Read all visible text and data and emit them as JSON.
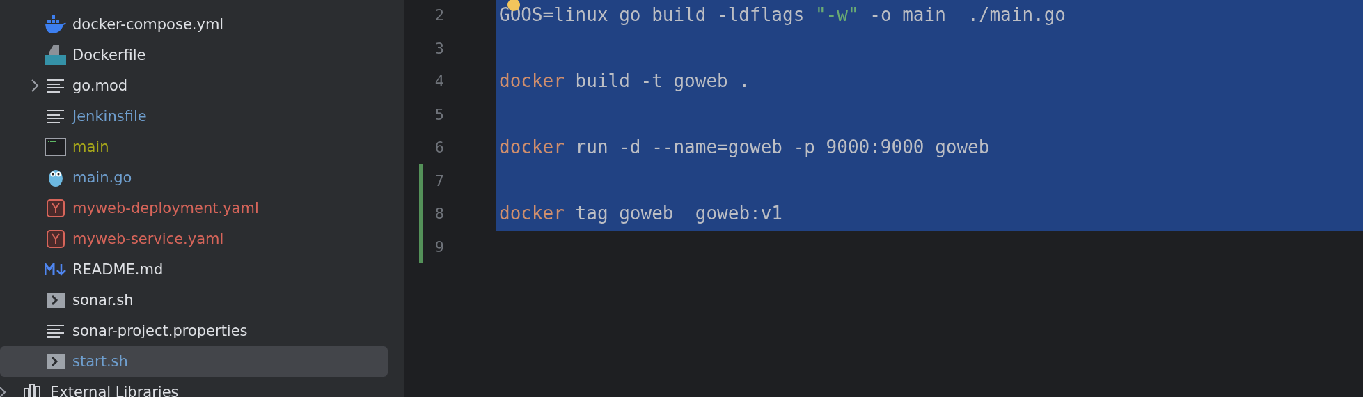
{
  "project_tree": {
    "items": [
      {
        "name": "docker-compose.yml",
        "kind": "docker",
        "color": "#dfe1e5",
        "has_children": false,
        "selected": false
      },
      {
        "name": "Dockerfile",
        "kind": "dockerfile",
        "color": "#dfe1e5",
        "has_children": false,
        "selected": false
      },
      {
        "name": "go.mod",
        "kind": "text",
        "color": "#dfe1e5",
        "has_children": true,
        "selected": false
      },
      {
        "name": "Jenkinsfile",
        "kind": "text",
        "color": "#6f9fcf",
        "has_children": false,
        "selected": false
      },
      {
        "name": "main",
        "kind": "binary",
        "color": "#a8a81a",
        "has_children": false,
        "selected": false
      },
      {
        "name": "main.go",
        "kind": "go",
        "color": "#6f9fcf",
        "has_children": false,
        "selected": false
      },
      {
        "name": "myweb-deployment.yaml",
        "kind": "yaml",
        "color": "#d7655a",
        "has_children": false,
        "selected": false
      },
      {
        "name": "myweb-service.yaml",
        "kind": "yaml",
        "color": "#d7655a",
        "has_children": false,
        "selected": false
      },
      {
        "name": "README.md",
        "kind": "markdown",
        "color": "#dfe1e5",
        "has_children": false,
        "selected": false
      },
      {
        "name": "sonar.sh",
        "kind": "shell",
        "color": "#dfe1e5",
        "has_children": false,
        "selected": false
      },
      {
        "name": "sonar-project.properties",
        "kind": "text",
        "color": "#dfe1e5",
        "has_children": false,
        "selected": false
      },
      {
        "name": "start.sh",
        "kind": "shell",
        "color": "#6f9fcf",
        "has_children": false,
        "selected": true
      }
    ],
    "external_libraries": {
      "label": "External Libraries"
    }
  },
  "editor": {
    "lines": [
      {
        "number": "2",
        "selected": true,
        "changed": false,
        "tokens": [
          {
            "kind": "plain",
            "text": "GOOS=linux go build -ldflags "
          },
          {
            "kind": "string",
            "text": "\"-w\""
          },
          {
            "kind": "plain",
            "text": " -o main  ./main.go"
          }
        ]
      },
      {
        "number": "3",
        "selected": true,
        "changed": false
      },
      {
        "number": "4",
        "selected": true,
        "changed": false,
        "tokens": [
          {
            "kind": "keyword",
            "text": "docker"
          },
          {
            "kind": "plain",
            "text": " build -t goweb ."
          }
        ]
      },
      {
        "number": "5",
        "selected": true,
        "changed": false
      },
      {
        "number": "6",
        "selected": true,
        "changed": false,
        "tokens": [
          {
            "kind": "keyword",
            "text": "docker"
          },
          {
            "kind": "plain",
            "text": " run -d --name=goweb -p 9000:9000 goweb"
          }
        ]
      },
      {
        "number": "7",
        "selected": true,
        "changed": true
      },
      {
        "number": "8",
        "selected": true,
        "changed": true,
        "tokens": [
          {
            "kind": "keyword",
            "text": "docker"
          },
          {
            "kind": "plain",
            "text": " tag goweb  goweb:v1"
          }
        ]
      },
      {
        "number": "9",
        "selected": false,
        "changed": true
      }
    ]
  }
}
